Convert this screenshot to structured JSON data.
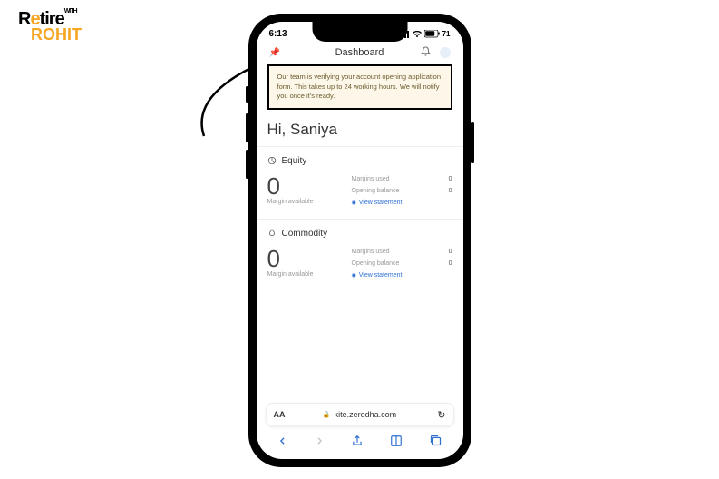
{
  "logo": {
    "top_left": "R",
    "top_mid": "e",
    "top_rest": "tire",
    "badge": "WITH",
    "bottom": "ROHIT"
  },
  "status": {
    "time": "6:13",
    "battery": "71"
  },
  "nav": {
    "title": "Dashboard"
  },
  "notice": "Our team is verifying your account opening application form. This takes up to 24 working hours. We will notify you once it's ready.",
  "greeting": "Hi, Saniya",
  "equity": {
    "title": "Equity",
    "available_value": "0",
    "available_label": "Margin available",
    "margins_used_label": "Margins used",
    "margins_used_value": "0",
    "opening_balance_label": "Opening balance",
    "opening_balance_value": "0",
    "view_link": "View statement"
  },
  "commodity": {
    "title": "Commodity",
    "available_value": "0",
    "available_label": "Margin available",
    "margins_used_label": "Margins used",
    "margins_used_value": "0",
    "opening_balance_label": "Opening balance",
    "opening_balance_value": "0",
    "view_link": "View statement"
  },
  "urlbar": {
    "aa": "AA",
    "domain": "kite.zerodha.com"
  }
}
